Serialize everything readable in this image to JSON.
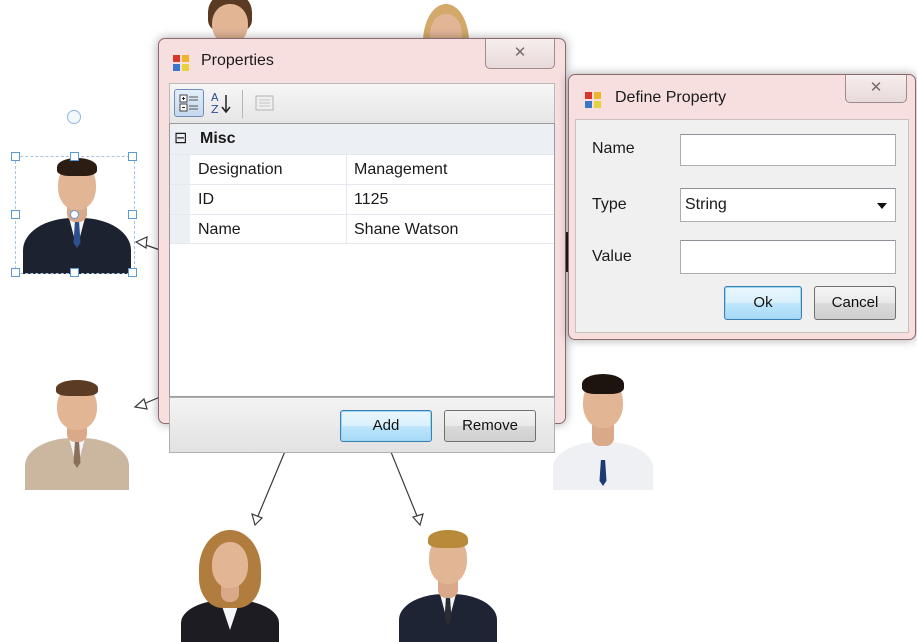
{
  "properties_window": {
    "title": "Properties",
    "close_glyph": "✕",
    "toolbar": {
      "categorized_icon": "categorized-view-icon",
      "alphabetical_icon": "alphabetical-sort-icon",
      "property_pages_icon": "property-pages-icon"
    },
    "category": {
      "expander": "⊟",
      "name": "Misc"
    },
    "rows": [
      {
        "name": "Designation",
        "value": "Management"
      },
      {
        "name": "ID",
        "value": "1125"
      },
      {
        "name": "Name",
        "value": "Shane Watson"
      }
    ],
    "buttons": {
      "add": "Add",
      "remove": "Remove"
    }
  },
  "define_property_window": {
    "title": "Define Property",
    "close_glyph": "✕",
    "fields": {
      "name_label": "Name",
      "name_value": "",
      "type_label": "Type",
      "type_selected": "String",
      "value_label": "Value",
      "value_value": ""
    },
    "buttons": {
      "ok": "Ok",
      "cancel": "Cancel"
    }
  },
  "colors": {
    "window_frame": "#f7dfe0",
    "category_band": "#eceff4",
    "default_button": "#bee6fd",
    "selection_handle": "#5b9bd5",
    "connector": "#333333"
  }
}
